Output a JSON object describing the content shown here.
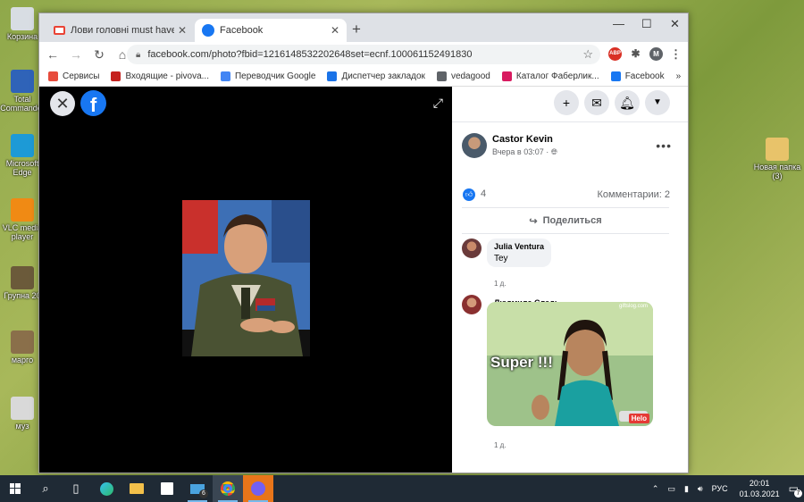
{
  "desktop": {
    "icons_left": [
      {
        "label": "Корзина",
        "color": "#d8dde3"
      },
      {
        "label": "Total Commander",
        "color": "#2f63b8"
      },
      {
        "label": "Microsoft Edge",
        "color": "#1d9ad6"
      },
      {
        "label": "VLC media player",
        "color": "#f08a14"
      },
      {
        "label": "Групна 20",
        "color": "#6b5a3a"
      },
      {
        "label": "марго",
        "color": "#8a6f4a"
      },
      {
        "label": "муз",
        "color": "#d9d9d9"
      }
    ],
    "icons_right": [
      {
        "label": "Новая папка (3)",
        "color": "#e8c36a"
      }
    ]
  },
  "browser": {
    "tabs": [
      {
        "title": "Лови головні must have цієї весни",
        "favicon": "gmail-icon",
        "active": false
      },
      {
        "title": "Facebook",
        "favicon": "facebook-icon",
        "active": true
      }
    ],
    "new_tab": "+",
    "window_controls": {
      "minimize": "—",
      "maximize": "☐",
      "close": "✕"
    },
    "url": "facebook.com/photo?fbid=1216148532202648set=ecnf.100061152491830",
    "profile_initial": "M",
    "ext_abp": "ABP",
    "bookmarks": [
      {
        "label": "Сервисы",
        "color": "#e74c3c"
      },
      {
        "label": "Входящие - pivova...",
        "color": "#c5221f"
      },
      {
        "label": "Переводчик Google",
        "color": "#4285f4"
      },
      {
        "label": "Диспетчер закладок",
        "color": "#1a73e8"
      },
      {
        "label": "vedagood",
        "color": "#5f6368"
      },
      {
        "label": "Каталог Фаберлик...",
        "color": "#d81b60"
      },
      {
        "label": "Facebook",
        "color": "#1877f2"
      }
    ],
    "bookmarks_more": "»"
  },
  "facebook": {
    "logo": "f",
    "post": {
      "author": "Castor Kevin",
      "time": "Вчера в 03:07 · ",
      "likes": "4",
      "comments_count": "Комментарии: 2",
      "share": "Поделиться"
    },
    "comments": [
      {
        "name": "Julia Ventura",
        "text": "Tey",
        "age": "1 д."
      },
      {
        "name": "Людмила Следь",
        "text": "",
        "age": "1 д."
      }
    ],
    "gif": {
      "caption": "Super !!!",
      "brand": "Helo",
      "site": "giftslog.com"
    }
  },
  "taskbar": {
    "lang": "РУС",
    "time": "20:01",
    "date": "01.03.2021",
    "mail_badge": "6",
    "notif_badge": "7"
  }
}
